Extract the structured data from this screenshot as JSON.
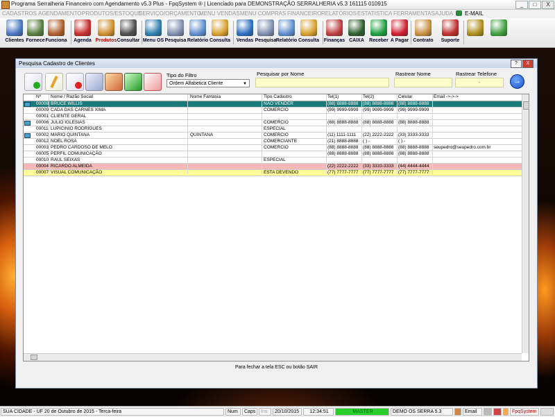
{
  "window": {
    "title": "Programa Serralheria Financeiro com Agendamento v5.3 Plus - FpqSystem ® | Licenciado para  DEMONSTRAÇÃO SERRALHERIA v5.3 161115 010915",
    "minimize": "_",
    "maximize": "□",
    "close": "X"
  },
  "menu": [
    "CADASTROS",
    "AGENDAMENTO",
    "PRODUTOS/ESTOQUE",
    "SERVIÇO/ORÇAMENTO",
    "MENU VENDAS",
    "MENU COMPRAS",
    "FINANCEIRO",
    "RELATÓRIOS",
    "ESTATISTICA",
    "FERRAMENTAS",
    "AJUDA",
    "E-MAIL"
  ],
  "toolbar": [
    {
      "label": "Clientes",
      "icon": "clients-icon",
      "color": "#4a78c0"
    },
    {
      "label": "Fornece",
      "icon": "supplier-icon",
      "color": "#5a8040"
    },
    {
      "label": "Funciona",
      "icon": "employee-icon",
      "color": "#b06030"
    },
    {
      "label": "Agenda",
      "icon": "calendar-icon",
      "color": "#c83030"
    },
    {
      "label": "Produtos",
      "icon": "products-icon",
      "color": "#d09030"
    },
    {
      "label": "Consultar",
      "icon": "dial-icon",
      "color": "#505050"
    },
    {
      "label": "Menu OS",
      "icon": "os-menu-icon",
      "color": "#3080b0"
    },
    {
      "label": "Pesquisa",
      "icon": "search-doc-icon",
      "color": "#8090b0"
    },
    {
      "label": "Relatório",
      "icon": "printer-icon",
      "color": "#6090d0"
    },
    {
      "label": "Consulta",
      "icon": "folder-icon",
      "color": "#d8a030"
    },
    {
      "label": "Vendas",
      "icon": "monitor-icon",
      "color": "#3070c0"
    },
    {
      "label": "Pesquisa",
      "icon": "search-doc-icon",
      "color": "#8090b0"
    },
    {
      "label": "Relatório",
      "icon": "printer-icon",
      "color": "#6090d0"
    },
    {
      "label": "Consulta",
      "icon": "folder-icon",
      "color": "#d8a030"
    },
    {
      "label": "Finanças",
      "icon": "flag-icon",
      "color": "#c04040"
    },
    {
      "label": "CAIXA",
      "icon": "cash-icon",
      "color": "#306030"
    },
    {
      "label": "Receber",
      "icon": "dollar-green-icon",
      "color": "#20a040"
    },
    {
      "label": "A Pagar",
      "icon": "dollar-red-icon",
      "color": "#d02030"
    },
    {
      "label": "Contrato",
      "icon": "contract-icon",
      "color": "#c89040"
    },
    {
      "label": "Suporte",
      "icon": "support-icon",
      "color": "#c03030"
    },
    {
      "label": "",
      "icon": "coin-icon",
      "color": "#b09020"
    },
    {
      "label": "",
      "icon": "exit-icon",
      "color": "#40a040"
    }
  ],
  "dialog": {
    "title": "Pesquisa Cadastro de Clientes",
    "help": "?",
    "close": "X",
    "filter_label": "Tipo do Filtro",
    "filter_value": "Ordem Alfabetica Cliente",
    "search_name_label": "Pesquisar por Nome",
    "search_name_value": "",
    "track_name_label": "Rastrear Nome",
    "track_name_value": "",
    "track_phone_label": "Rastrear Telefone",
    "track_phone_value": "-",
    "go": "→",
    "footnote": "Para fechar a tela ESC ou botão SAIR"
  },
  "grid": {
    "headers": [
      "Nº",
      "Nome / Razão Social",
      "Nome Fantasia",
      "Tipo Cadastro",
      "Tel(1)",
      "Tel(2)",
      "Celular",
      "Email ->->->"
    ],
    "rows": [
      {
        "n": "00008",
        "nome": "BRUCE WILLIS",
        "fantasia": "",
        "tipo": "NÃO VENDER",
        "tel1": "(88) 8888-8888",
        "tel2": "(88) 8888-8888",
        "cel": "(88) 8888-8888",
        "email": "",
        "style": "selected",
        "mark": true
      },
      {
        "n": "00009",
        "nome": "CADA DAS CARNES XIMA",
        "fantasia": "",
        "tipo": "COMERCIO",
        "tel1": "(99) 9999-9999",
        "tel2": "(99) 9999-9999",
        "cel": "(99) 9999-9999",
        "email": "",
        "style": "",
        "mark": false
      },
      {
        "n": "00001",
        "nome": "CLIENTE GERAL",
        "fantasia": "",
        "tipo": "",
        "tel1": "",
        "tel2": "",
        "cel": "",
        "email": "",
        "style": "",
        "mark": false
      },
      {
        "n": "00006",
        "nome": "JULIO IGLESIAS",
        "fantasia": "",
        "tipo": "COMERCIO",
        "tel1": "(88) 8888-8888",
        "tel2": "(88) 8888-8888",
        "cel": "(88) 8888-8888",
        "email": "",
        "style": "",
        "mark": true
      },
      {
        "n": "00011",
        "nome": "LUPICINIO RODRIGUES",
        "fantasia": "",
        "tipo": "ESPECIAL",
        "tel1": "",
        "tel2": "",
        "cel": "",
        "email": "",
        "style": "",
        "mark": false
      },
      {
        "n": "00002",
        "nome": "MARIO QUINTANA",
        "fantasia": "QUINTANA",
        "tipo": "COMERCIO",
        "tel1": "(11) 1111-1111",
        "tel2": "(22) 2222-2222",
        "cel": "(33) 3333-3333",
        "email": "",
        "style": "",
        "mark": true
      },
      {
        "n": "00012",
        "nome": "NOEL ROSA",
        "fantasia": "",
        "tipo": "COMERCIANTE",
        "tel1": "(21) 8888-8888",
        "tel2": "(  )    -",
        "cel": "(  )    -",
        "email": "",
        "style": "",
        "mark": false
      },
      {
        "n": "00003",
        "nome": "PEDRO CARDOSO DE MELO",
        "fantasia": "",
        "tipo": "COMERCIO",
        "tel1": "(88) 8888-8888",
        "tel2": "(88) 8888-8888",
        "cel": "(88) 8888-8888",
        "email": "seupedro@seupedro.com.br",
        "style": "",
        "mark": false
      },
      {
        "n": "00005",
        "nome": "PERFIL COMUNICAÇÃO",
        "fantasia": "",
        "tipo": "",
        "tel1": "(88) 8888-8888",
        "tel2": "(88) 8888-8888",
        "cel": "(88) 8888-8888",
        "email": "",
        "style": "",
        "mark": false
      },
      {
        "n": "00010",
        "nome": "RAUL SEIXAS",
        "fantasia": "",
        "tipo": "ESPECIAL",
        "tel1": "",
        "tel2": "",
        "cel": "",
        "email": "",
        "style": "",
        "mark": false
      },
      {
        "n": "00004",
        "nome": "RICARDO ALMEIDA",
        "fantasia": "",
        "tipo": "",
        "tel1": "(22) 2222-2222",
        "tel2": "(33) 3333-3333",
        "cel": "(44) 4444-4444",
        "email": "",
        "style": "red",
        "mark": false
      },
      {
        "n": "00007",
        "nome": "VISUAL COMUNICAÇÃO",
        "fantasia": "",
        "tipo": "ESTA DEVENDO",
        "tel1": "(77) 7777-7777",
        "tel2": "(77) 7777-7777",
        "cel": "(77) 7777-7777",
        "email": "",
        "style": "yellow",
        "mark": false
      }
    ]
  },
  "status": {
    "city": "SUA CIDADE - UF 20 de Outubro de 2015 - Terca-feira",
    "num": "Num",
    "caps": "Caps",
    "ins": "Ins",
    "date": "20/10/2015",
    "time": "12:34:51",
    "user": "MASTER",
    "demo": "DEMO OS SERRA 5.3",
    "email": "Email",
    "brand": "FpqSystem"
  },
  "colors": {
    "selected_row": "#1a7a7a",
    "red_row": "#f4b8b8",
    "yellow_row": "#ffff99",
    "brand_red": "#c00000"
  }
}
